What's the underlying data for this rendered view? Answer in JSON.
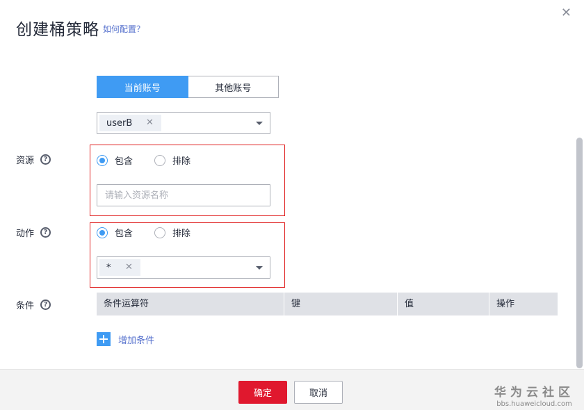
{
  "dialog": {
    "title": "创建桶策略",
    "help_link": "如何配置？",
    "close_icon": "close-icon"
  },
  "account_switch": {
    "options": [
      "当前账号",
      "其他账号"
    ],
    "selected": "当前账号"
  },
  "user_select": {
    "tags": [
      "userB"
    ]
  },
  "resource": {
    "label": "资源",
    "radio_options": [
      "包含",
      "排除"
    ],
    "selected": "包含",
    "input_placeholder": "请输入资源名称"
  },
  "action": {
    "label": "动作",
    "radio_options": [
      "包含",
      "排除"
    ],
    "selected": "包含",
    "tags": [
      "*"
    ]
  },
  "condition": {
    "label": "条件",
    "columns": [
      "条件运算符",
      "键",
      "值",
      "操作"
    ],
    "add_label": "增加条件"
  },
  "footer": {
    "confirm": "确定",
    "cancel": "取消",
    "watermark_cn": "华为云社区",
    "watermark_url": "bbs.huaweicloud.com"
  },
  "colors": {
    "primary_blue": "#3f9bf3",
    "danger_red": "#e0182e",
    "highlight_border": "#e02020",
    "link": "#526ecc"
  }
}
